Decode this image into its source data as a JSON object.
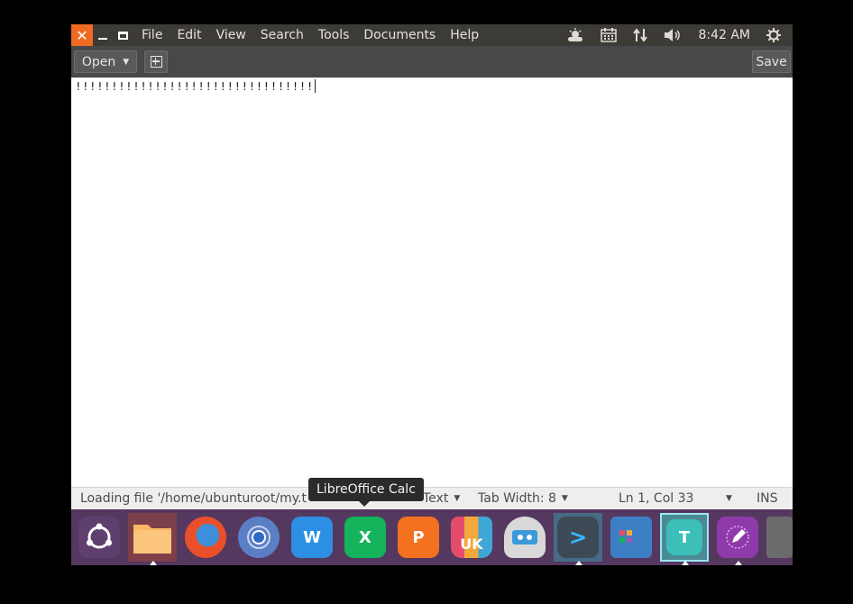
{
  "window": {
    "close_icon": "x-icon",
    "min_icon": "minimize-icon",
    "max_icon": "maximize-icon"
  },
  "menubar": {
    "items": [
      "File",
      "Edit",
      "View",
      "Search",
      "Tools",
      "Documents",
      "Help"
    ]
  },
  "indicators": {
    "weather_icon": "weather-icon",
    "calendar_icon": "calendar-icon",
    "network_icon": "network-transfer-icon",
    "volume_icon": "volume-icon",
    "clock": "8:42 AM",
    "settings_icon": "gear-icon"
  },
  "toolbar": {
    "open_label": "Open",
    "save_label": "Save"
  },
  "editor": {
    "content": "!!!!!!!!!!!!!!!!!!!!!!!!!!!!!!!!!"
  },
  "statusbar": {
    "loading_text": "Loading file '/home/ubunturoot/my.t",
    "language": "Text",
    "tab_width": "Tab Width: 8",
    "position": "Ln 1, Col 33",
    "mode": "INS"
  },
  "tooltip": {
    "text": "LibreOffice Calc"
  },
  "colors": {
    "panel_bg": "#3c3b37",
    "close_btn": "#f06a24",
    "toolbar_bg": "#48474a",
    "launcher_bg": "#55385f"
  },
  "launcher": {
    "apps": [
      {
        "name": "ubuntu-dash",
        "icon": "ubuntu-logo-icon",
        "text": ""
      },
      {
        "name": "files",
        "icon": "folder-icon",
        "text": ""
      },
      {
        "name": "firefox",
        "icon": "firefox-icon",
        "text": ""
      },
      {
        "name": "chromium",
        "icon": "chromium-icon",
        "text": ""
      },
      {
        "name": "writer",
        "icon": "word-icon",
        "text": "W"
      },
      {
        "name": "calc",
        "icon": "spreadsheet-icon",
        "text": "X"
      },
      {
        "name": "impress",
        "icon": "presentation-icon",
        "text": "P"
      },
      {
        "name": "software-center",
        "icon": "shopping-bag-icon",
        "text": "UK"
      },
      {
        "name": "remote-desktop",
        "icon": "remote-desktop-icon",
        "text": ""
      },
      {
        "name": "terminal",
        "icon": "terminal-icon",
        "text": ">"
      },
      {
        "name": "workspaces",
        "icon": "workspace-switcher-icon",
        "text": ""
      },
      {
        "name": "text-editor",
        "icon": "text-editor-icon",
        "text": "T"
      },
      {
        "name": "editor-alt",
        "icon": "pen-icon",
        "text": ""
      },
      {
        "name": "trash",
        "icon": "trash-icon",
        "text": ""
      }
    ]
  }
}
